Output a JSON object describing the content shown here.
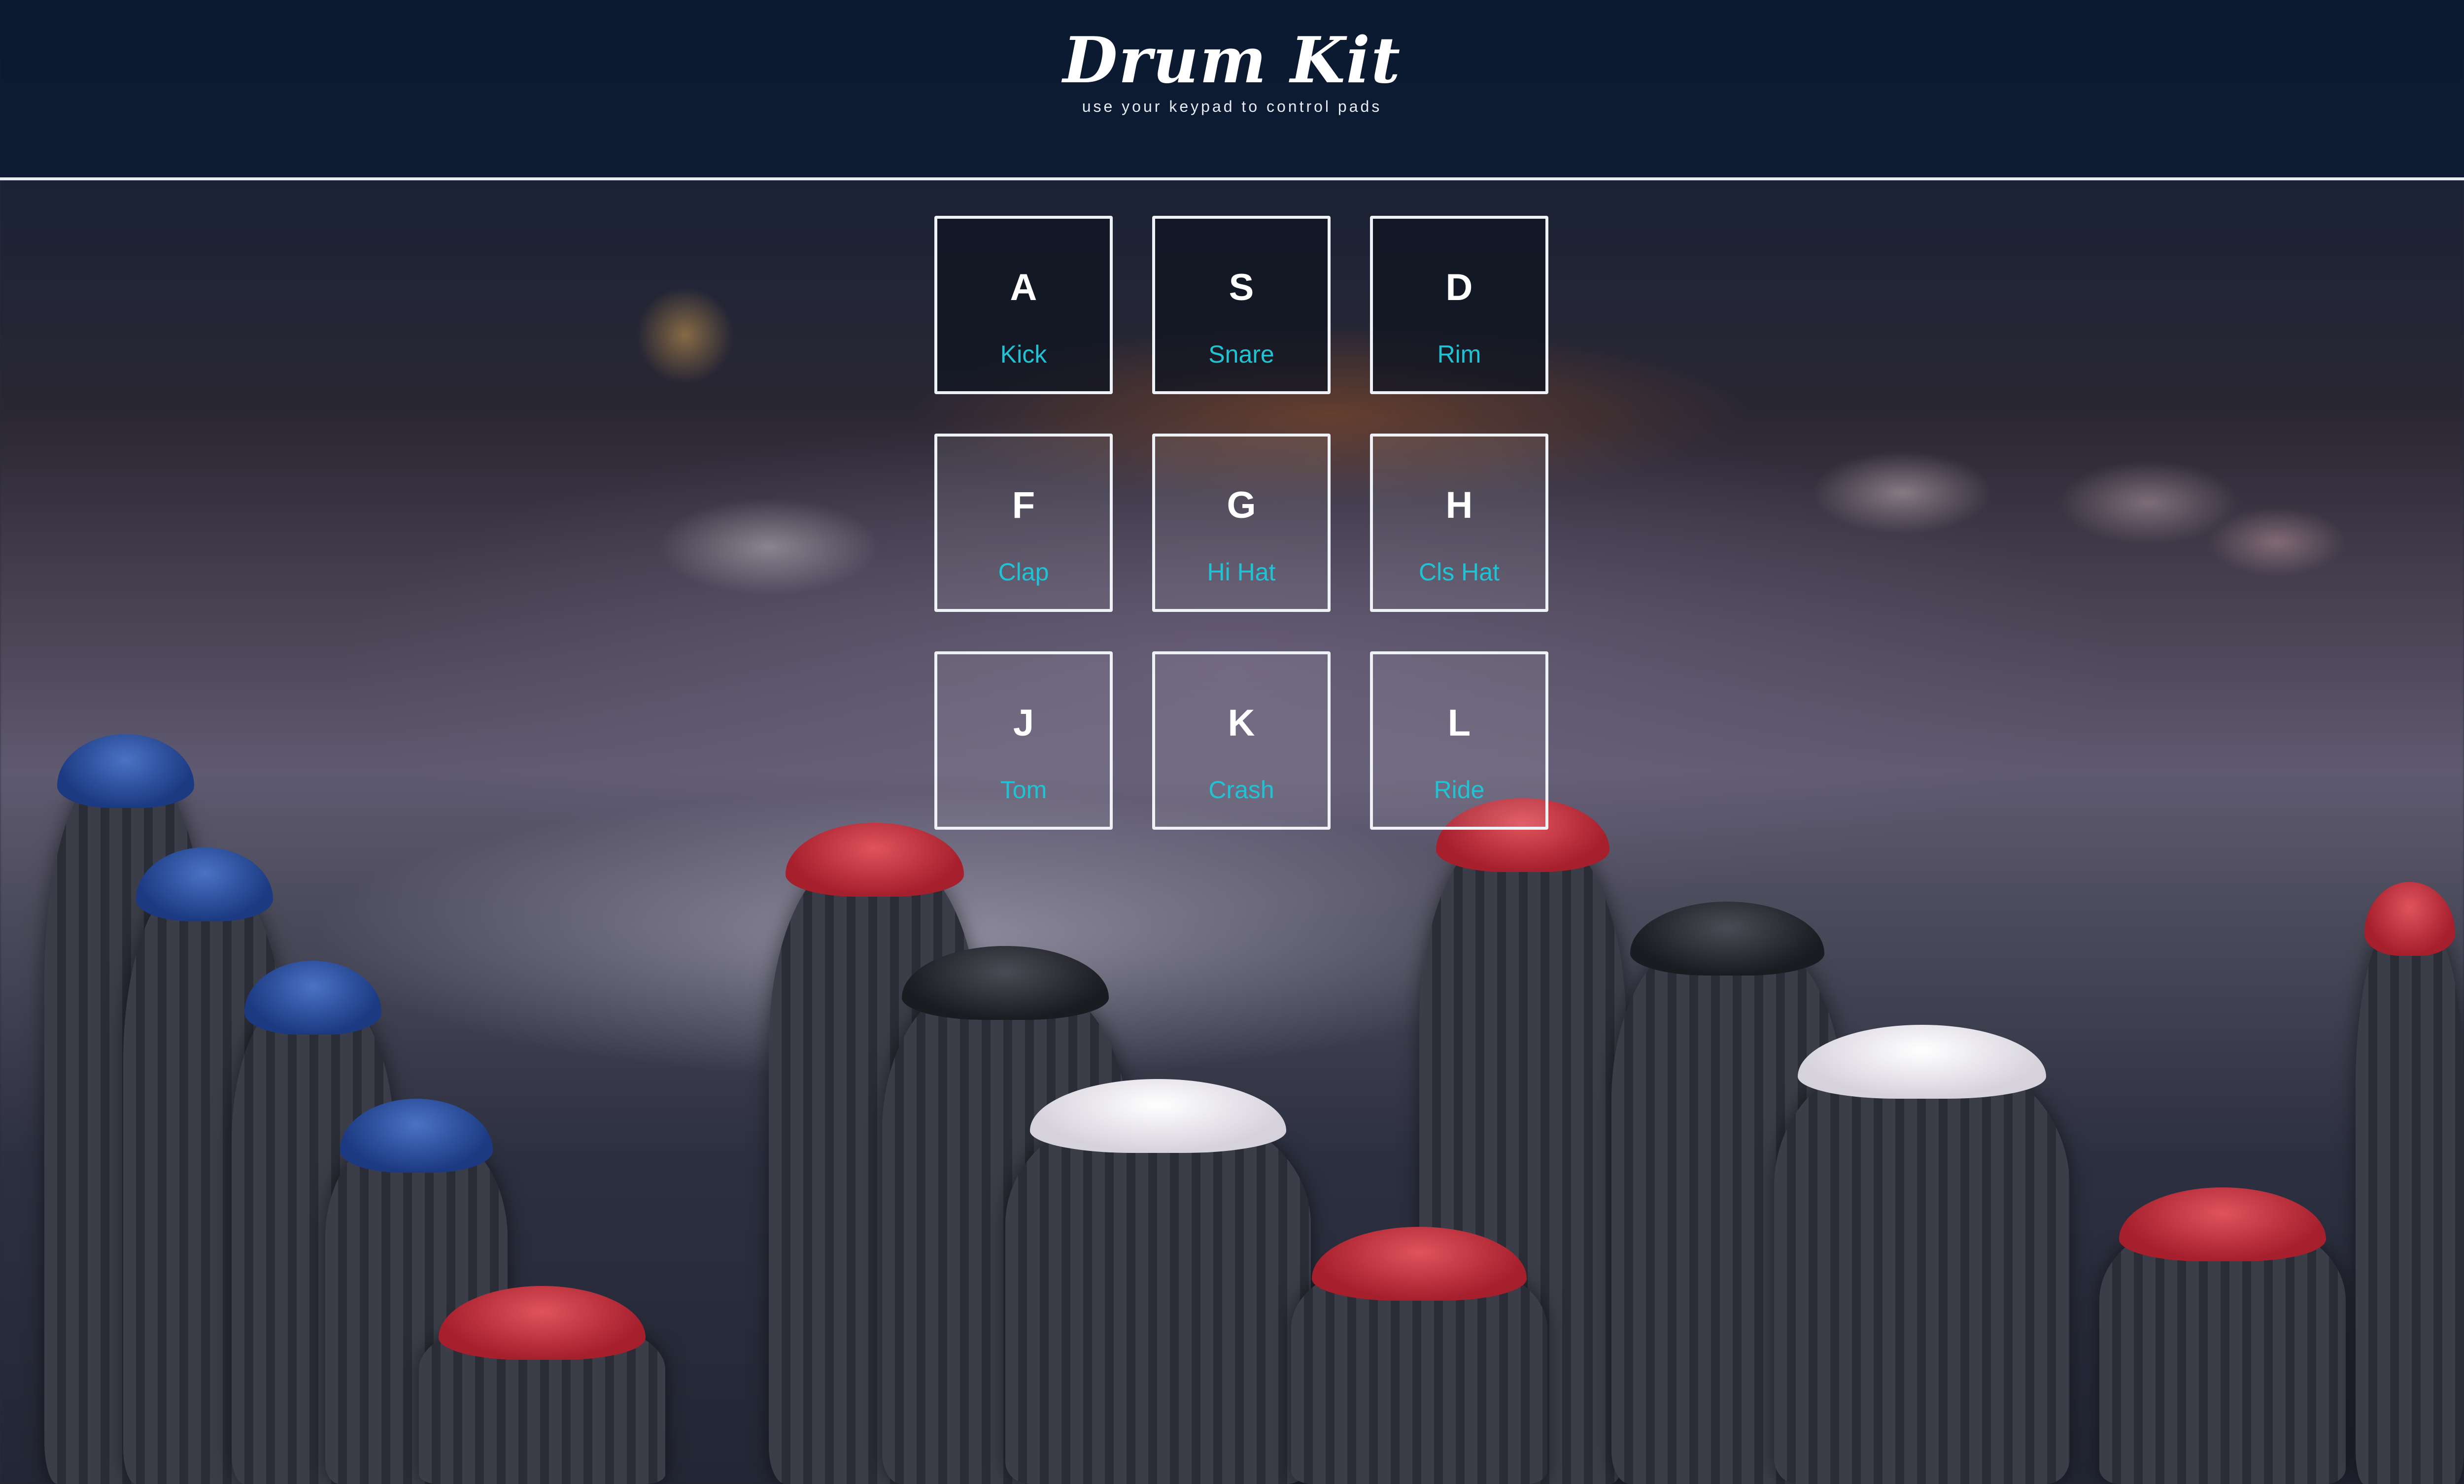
{
  "header": {
    "title": "Drum Kit",
    "subtitle": "use your keypad to control pads"
  },
  "pads": [
    {
      "key": "A",
      "sound": "Kick"
    },
    {
      "key": "S",
      "sound": "Snare"
    },
    {
      "key": "D",
      "sound": "Rim"
    },
    {
      "key": "F",
      "sound": "Clap"
    },
    {
      "key": "G",
      "sound": "Hi Hat"
    },
    {
      "key": "H",
      "sound": "Cls Hat"
    },
    {
      "key": "J",
      "sound": "Tom"
    },
    {
      "key": "K",
      "sound": "Crash"
    },
    {
      "key": "L",
      "sound": "Ride"
    }
  ],
  "colors": {
    "header_bg": "#0a1a32",
    "pad_border": "#eef1f6",
    "key_text": "#ffffff",
    "sound_text": "#1fc3d4"
  }
}
